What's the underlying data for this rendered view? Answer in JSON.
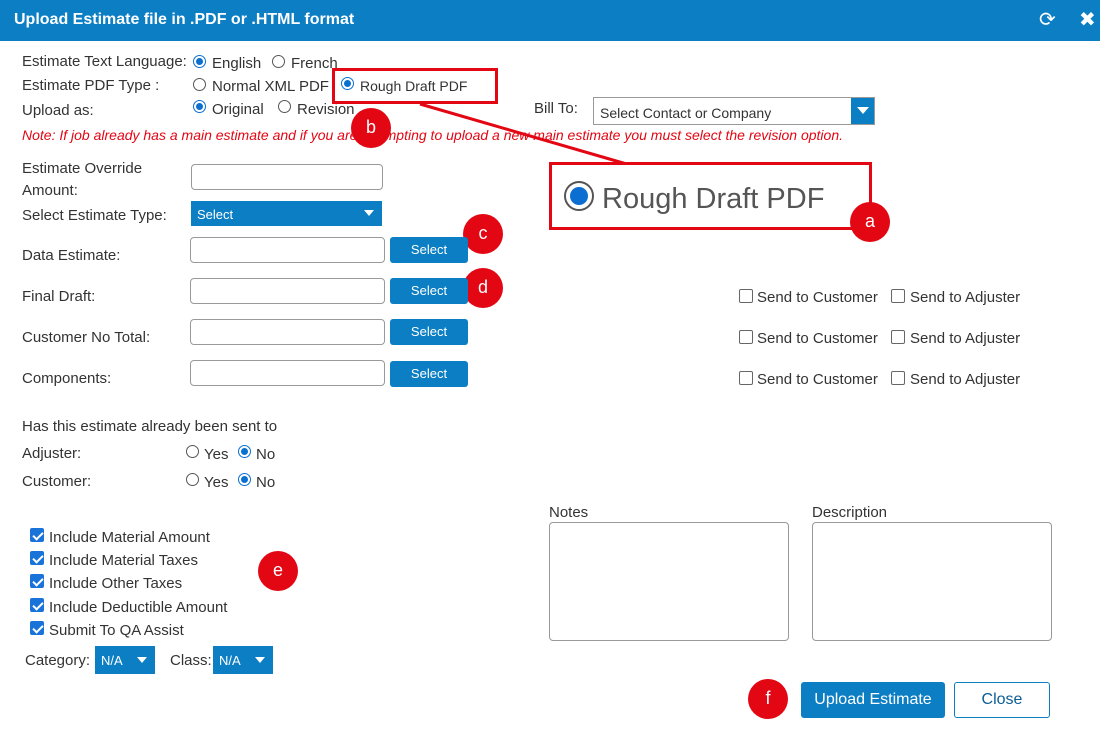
{
  "window": {
    "title": "Upload Estimate file in .PDF or .HTML format",
    "refresh_icon": "refresh-icon",
    "close_icon": "close-icon"
  },
  "colors": {
    "accent": "#0b7ec4",
    "annotation": "#e30613",
    "note": "#e30613"
  },
  "language": {
    "label": "Estimate Text Language:",
    "options": [
      "English",
      "French"
    ],
    "selected": "English"
  },
  "pdf_type": {
    "label": "Estimate PDF Type :",
    "options": [
      "Normal XML PDF",
      "Rough Draft PDF"
    ],
    "selected": "Rough Draft PDF"
  },
  "upload_as": {
    "label": "Upload as:",
    "options": [
      "Original",
      "Revision"
    ],
    "selected": "Original"
  },
  "bill_to": {
    "label": "Bill To:",
    "placeholder": "Select Contact or Company"
  },
  "note": "Note: If job already has a main estimate and if you are attempting to upload a new main estimate you must select the revision option.",
  "override": {
    "label_line1": "Estimate Override",
    "label_line2": "Amount:",
    "value": ""
  },
  "estimate_type": {
    "label": "Select Estimate Type:",
    "selected": "Select"
  },
  "files": [
    {
      "label": "Data Estimate:",
      "value": "",
      "button": "Select",
      "send_options": false
    },
    {
      "label": "Final Draft:",
      "value": "",
      "button": "Select",
      "send_options": true
    },
    {
      "label": "Customer No Total:",
      "value": "",
      "button": "Select",
      "send_options": true
    },
    {
      "label": "Components:",
      "value": "",
      "button": "Select",
      "send_options": true
    }
  ],
  "send": {
    "customer": "Send to Customer",
    "adjuster": "Send to Adjuster"
  },
  "already_sent": {
    "question": "Has this estimate already been sent to",
    "adjuster_label": "Adjuster:",
    "customer_label": "Customer:",
    "yes": "Yes",
    "no": "No",
    "adjuster_selected": "No",
    "customer_selected": "No"
  },
  "checkboxes": [
    {
      "label": "Include Material Amount",
      "checked": true
    },
    {
      "label": "Include Material Taxes",
      "checked": true
    },
    {
      "label": "Include Other Taxes",
      "checked": true
    },
    {
      "label": "Include Deductible Amount",
      "checked": true
    },
    {
      "label": "Submit To QA Assist",
      "checked": true
    }
  ],
  "category": {
    "label": "Category:",
    "selected": "N/A"
  },
  "class": {
    "label": "Class:",
    "selected": "N/A"
  },
  "notes": {
    "label": "Notes",
    "value": ""
  },
  "description": {
    "label": "Description",
    "value": ""
  },
  "buttons": {
    "upload": "Upload Estimate",
    "close": "Close"
  },
  "callout": {
    "text": "Rough Draft PDF"
  },
  "markers": [
    "a",
    "b",
    "c",
    "d",
    "e",
    "f"
  ]
}
